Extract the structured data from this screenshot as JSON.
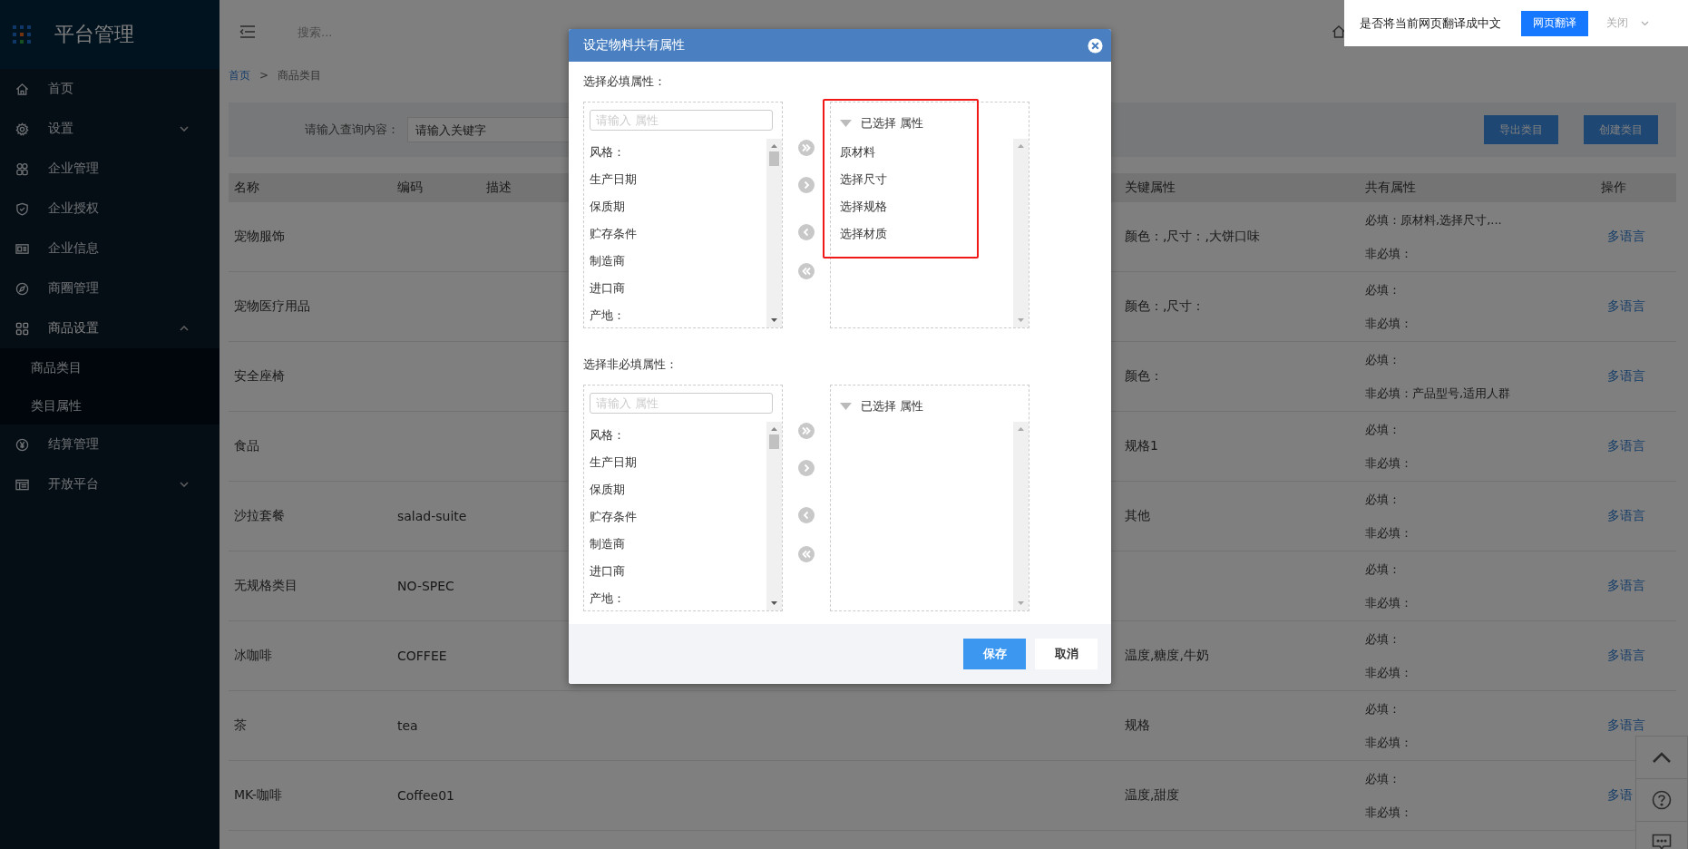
{
  "sidebar": {
    "title": "平台管理",
    "items": [
      {
        "label": "首页",
        "kind": "link",
        "expanded": false
      },
      {
        "label": "设置",
        "kind": "group",
        "expanded": false
      },
      {
        "label": "企业管理",
        "kind": "link",
        "expanded": false
      },
      {
        "label": "企业授权",
        "kind": "link",
        "expanded": false
      },
      {
        "label": "企业信息",
        "kind": "link",
        "expanded": false
      },
      {
        "label": "商圈管理",
        "kind": "link",
        "expanded": false
      },
      {
        "label": "商品设置",
        "kind": "group",
        "expanded": true,
        "children": [
          {
            "label": "商品类目"
          },
          {
            "label": "类目属性"
          }
        ]
      },
      {
        "label": "结算管理",
        "kind": "link",
        "expanded": false
      },
      {
        "label": "开放平台",
        "kind": "group",
        "expanded": false
      }
    ]
  },
  "header": {
    "search_placeholder": "搜索..."
  },
  "translate_bar": {
    "prompt": "是否将当前网页翻译成中文",
    "translate_button": "网页翻译",
    "close_button": "关闭"
  },
  "breadcrumb": {
    "items": [
      "首页",
      "商品类目"
    ],
    "separator": ">"
  },
  "filter": {
    "label": "请输入查询内容：",
    "placeholder": "请输入关键字",
    "buttons": [
      "导出类目",
      "创建类目"
    ]
  },
  "table": {
    "columns": [
      "名称",
      "编码",
      "描述",
      "关键属性",
      "共有属性",
      "操作"
    ],
    "rows": [
      {
        "name": "宠物服饰",
        "code": "",
        "key_attributes": "颜色：,尺寸：,大饼口味",
        "required": "必填：原材料,选择尺寸,...",
        "optional": "非必填：",
        "action": "多语言"
      },
      {
        "name": "宠物医疗用品",
        "code": "",
        "key_attributes": "颜色：,尺寸：",
        "required": "必填：",
        "optional": "非必填：",
        "action": "多语言"
      },
      {
        "name": "安全座椅",
        "code": "",
        "key_attributes": "颜色：",
        "required": "必填：",
        "optional": "非必填：产品型号,适用人群",
        "action": "多语言"
      },
      {
        "name": "食品",
        "code": "",
        "key_attributes": "规格1",
        "required": "必填：",
        "optional": "非必填：",
        "action": "多语言"
      },
      {
        "name": "沙拉套餐",
        "code": "salad-suite",
        "key_attributes": "其他",
        "required": "必填：",
        "optional": "非必填：",
        "action": "多语言"
      },
      {
        "name": "无规格类目",
        "code": "NO-SPEC",
        "key_attributes": "",
        "required": "必填：",
        "optional": "非必填：",
        "action": "多语言"
      },
      {
        "name": "冰咖啡",
        "code": "COFFEE",
        "key_attributes": "温度,糖度,牛奶",
        "required": "必填：",
        "optional": "非必填：",
        "action": "多语言"
      },
      {
        "name": "茶",
        "code": "tea",
        "key_attributes": "规格",
        "required": "必填：",
        "optional": "非必填：",
        "action": "多语言"
      },
      {
        "name": "MK-咖啡",
        "code": "Coffee01",
        "key_attributes": "温度,甜度",
        "required": "必填：",
        "optional": "非必填：",
        "action": "多语"
      }
    ]
  },
  "modal": {
    "title": "设定物料共有属性",
    "sections": [
      {
        "label": "选择必填属性：",
        "search_placeholder": "请输入 属性",
        "options": [
          "风格：",
          "生产日期",
          "保质期",
          "贮存条件",
          "制造商",
          "进口商",
          "产地："
        ],
        "selected_header": "已选择 属性",
        "selected": [
          "原材料",
          "选择尺寸",
          "选择规格",
          "选择材质"
        ],
        "highlighted": true
      },
      {
        "label": "选择非必填属性：",
        "search_placeholder": "请输入 属性",
        "options": [
          "风格：",
          "生产日期",
          "保质期",
          "贮存条件",
          "制造商",
          "进口商",
          "产地："
        ],
        "selected_header": "已选择 属性",
        "highlighted": false
      }
    ],
    "buttons": [
      {
        "label": "保存",
        "kind": "primary"
      },
      {
        "label": "取消",
        "kind": "default"
      }
    ]
  }
}
